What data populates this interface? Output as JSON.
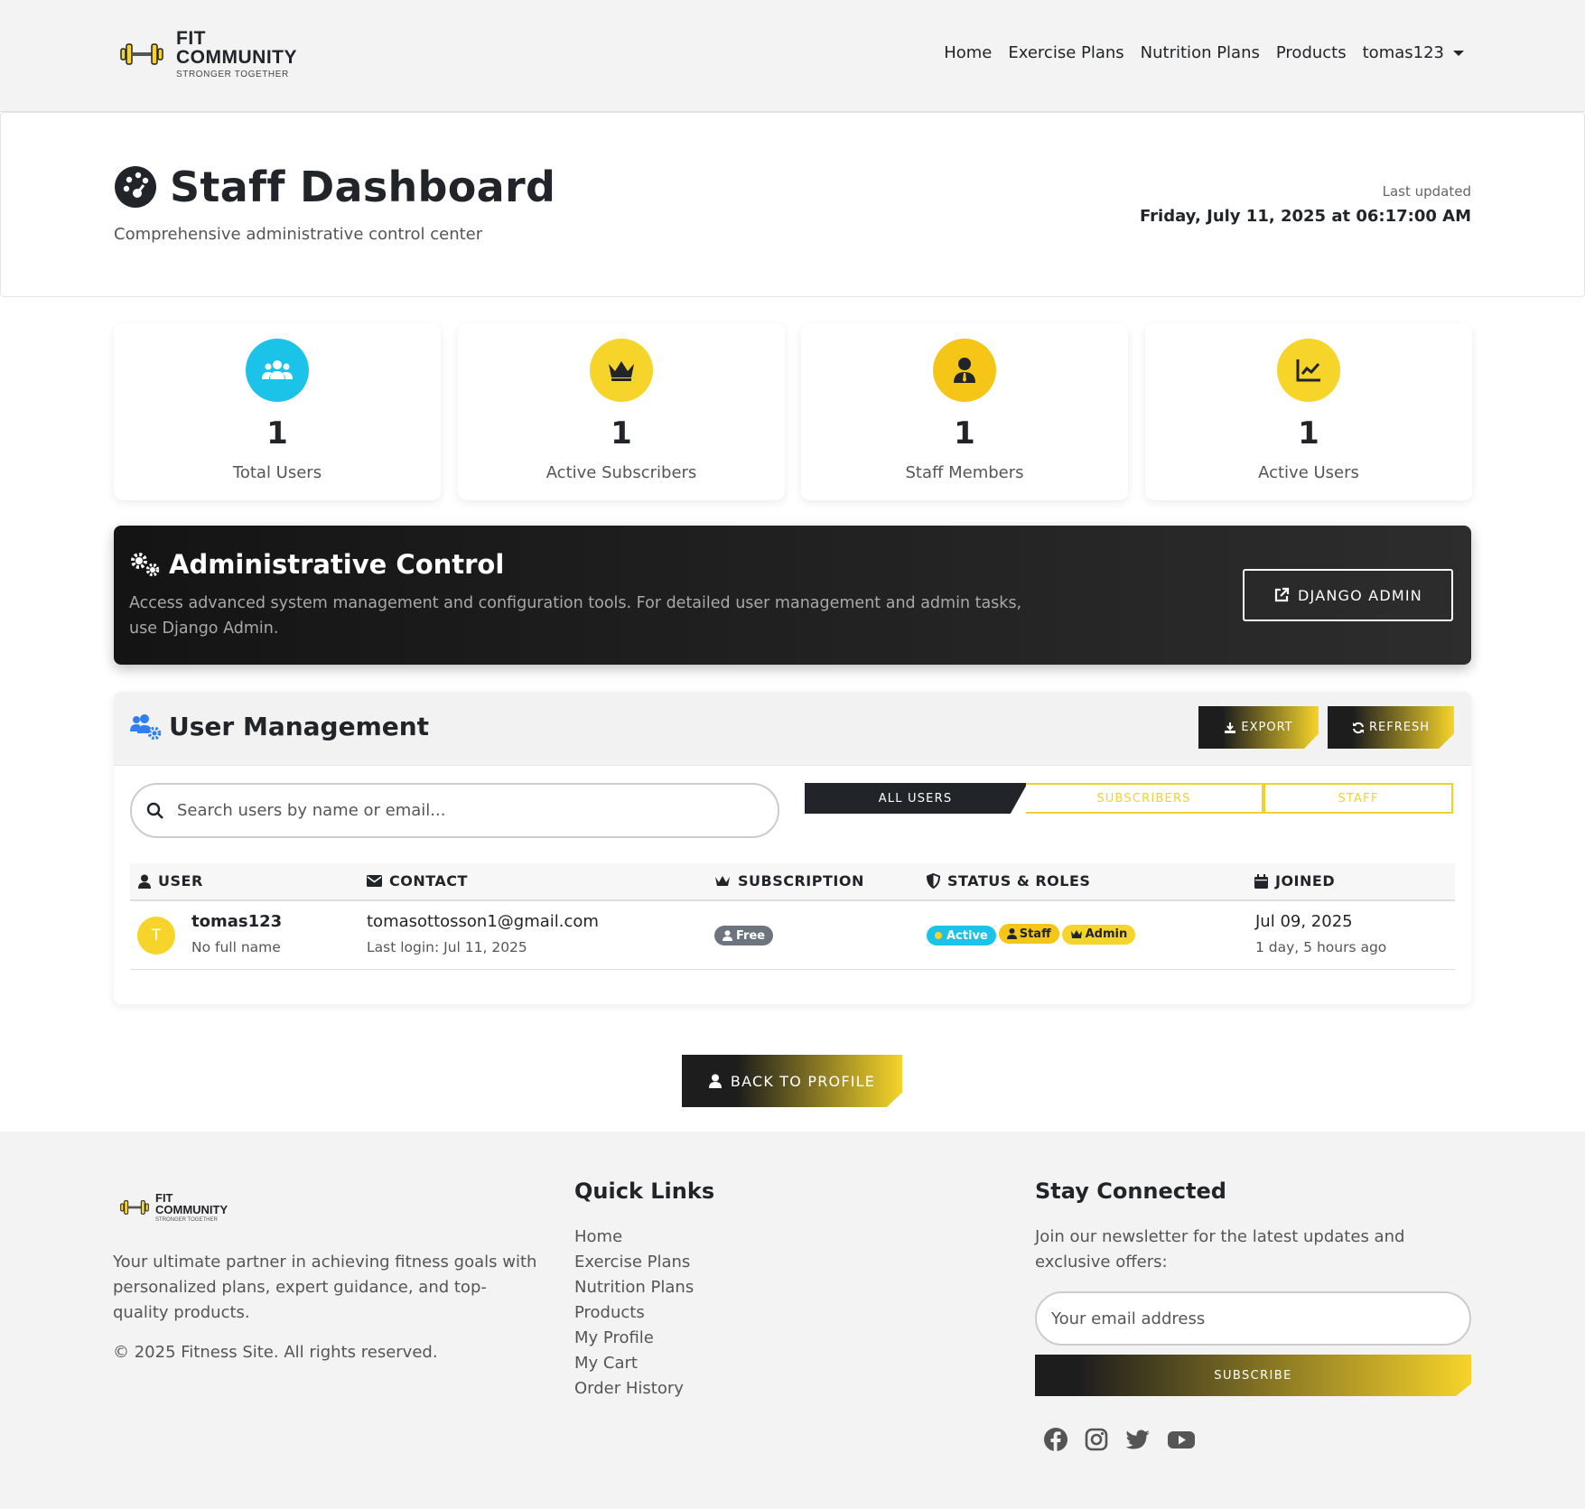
{
  "brand": {
    "line1": "FIT",
    "line2": "COMMUNITY",
    "tagline": "STRONGER TOGETHER"
  },
  "nav": {
    "items": [
      "Home",
      "Exercise Plans",
      "Nutrition Plans",
      "Products"
    ],
    "user": "tomas123"
  },
  "header": {
    "title": "Staff Dashboard",
    "subtitle": "Comprehensive administrative control center",
    "updated_label": "Last updated",
    "updated_value": "Friday, July 11, 2025 at 06:17:00 AM"
  },
  "stats": [
    {
      "value": "1",
      "label": "Total Users",
      "icon": "users-icon",
      "color": "#1cc3e8"
    },
    {
      "value": "1",
      "label": "Active Subscribers",
      "icon": "crown-icon",
      "color": "#f6d42a"
    },
    {
      "value": "1",
      "label": "Staff Members",
      "icon": "user-tie-icon",
      "color": "#f5c518"
    },
    {
      "value": "1",
      "label": "Active Users",
      "icon": "chart-line-icon",
      "color": "#f6d42a"
    }
  ],
  "admin": {
    "title": "Administrative Control",
    "description": "Access advanced system management and configuration tools. For detailed user management and admin tasks, use Django Admin.",
    "button": "DJANGO ADMIN"
  },
  "user_management": {
    "title": "User Management",
    "export": "EXPORT",
    "refresh": "REFRESH",
    "search_placeholder": "Search users by name or email...",
    "tabs": [
      "ALL USERS",
      "SUBSCRIBERS",
      "STAFF"
    ],
    "columns": [
      "USER",
      "CONTACT",
      "SUBSCRIPTION",
      "STATUS & ROLES",
      "JOINED"
    ],
    "rows": [
      {
        "initial": "T",
        "username": "tomas123",
        "fullname": "No full name",
        "email": "tomasottosson1@gmail.com",
        "last_login": "Last login: Jul 11, 2025",
        "subscription": "Free",
        "badges": [
          "Active",
          "Staff",
          "Admin"
        ],
        "joined": "Jul 09, 2025",
        "joined_ago": "1 day, 5 hours ago"
      }
    ]
  },
  "back_button": "BACK TO PROFILE",
  "footer": {
    "description": "Your ultimate partner in achieving fitness goals with personalized plans, expert guidance, and top-quality products.",
    "copyright": "© 2025 Fitness Site. All rights reserved.",
    "quick_links_title": "Quick Links",
    "links": [
      "Home",
      "Exercise Plans",
      "Nutrition Plans",
      "Products",
      "My Profile",
      "My Cart",
      "Order History"
    ],
    "connect_title": "Stay Connected",
    "newsletter": "Join our newsletter for the latest updates and exclusive offers:",
    "email_placeholder": "Your email address",
    "subscribe": "SUBSCRIBE",
    "social": [
      "facebook-icon",
      "instagram-icon",
      "twitter-icon",
      "youtube-icon"
    ]
  },
  "colors": {
    "accent": "#f6d42a",
    "dark": "#212529",
    "cyan": "#1cc3e8"
  }
}
